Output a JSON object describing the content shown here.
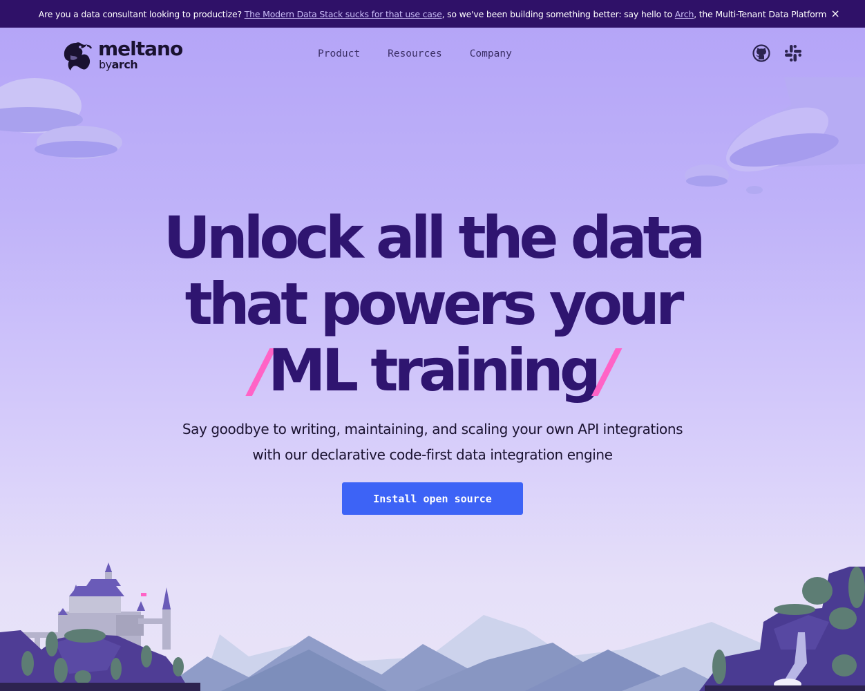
{
  "banner": {
    "prefix": "Are you a data consultant looking to productize?",
    "link1": "The Modern Data Stack sucks for that use case",
    "middle": ", so we've been building something better: say hello to",
    "link2": "Arch",
    "suffix": ", the Multi-Tenant Data Platform",
    "close_icon": "×"
  },
  "nav": {
    "logo_word": "meltano",
    "logo_sub_by": "by",
    "logo_sub_arch": "arch",
    "items": [
      {
        "label": "Product"
      },
      {
        "label": "Resources"
      },
      {
        "label": "Company"
      }
    ],
    "social": [
      {
        "icon": "github-icon"
      },
      {
        "icon": "slack-icon"
      }
    ]
  },
  "hero": {
    "line1": "Unlock all the data",
    "line2": "that powers your",
    "slash_left": "/",
    "line3": "ML training",
    "slash_right": "/",
    "subtitle_line1": "Say goodbye to writing, maintaining, and scaling your own API integrations",
    "subtitle_line2": "with our declarative code-first data integration engine",
    "cta_label": "Install open source"
  },
  "colors": {
    "banner_bg": "#2f1168",
    "title": "#2f1570",
    "accent_slash": "#ff63c6",
    "cta": "#3d63f6"
  }
}
